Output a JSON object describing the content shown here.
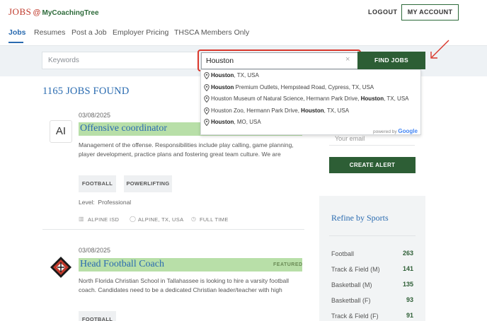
{
  "header": {
    "logo_jobs": "JOBS",
    "logo_at": "@",
    "logo_brand": "MyCoachingTree",
    "logout_label": "LOGOUT",
    "account_label": "MY ACCOUNT"
  },
  "nav": {
    "tabs": [
      {
        "label": "Jobs",
        "active": true
      },
      {
        "label": "Resumes"
      },
      {
        "label": "Post a Job"
      },
      {
        "label": "Employer Pricing"
      },
      {
        "label": "THSCA Members Only"
      }
    ]
  },
  "search": {
    "keywords_placeholder": "Keywords",
    "location_value": "Houston",
    "clear_icon": "×",
    "find_label": "FIND JOBS"
  },
  "autocomplete": {
    "items": [
      {
        "bold": "Houston",
        "rest": ", TX, USA"
      },
      {
        "bold": "Houston",
        "rest": " Premium Outlets, Hempstead Road, Cypress, TX, USA"
      },
      {
        "pre": "Houston Museum of Natural Science, Hermann Park Drive, ",
        "bold": "Houston",
        "rest": ", TX, USA"
      },
      {
        "pre": "Houston Zoo, Hermann Park Drive, ",
        "bold": "Houston",
        "rest": ", TX, USA"
      },
      {
        "bold": "Houston",
        "rest": ", MO, USA"
      }
    ],
    "powered_by": "powered by",
    "google": "Google"
  },
  "results": {
    "count_text": "1165 JOBS FOUND",
    "jobs": [
      {
        "logo_text": "AI",
        "date": "03/08/2025",
        "title": "Offensive coordinator",
        "description": "Management of the offense. Responsibilities include play calling, game planning, player development, practice plans and fostering great team culture. We are",
        "tags": [
          "FOOTBALL",
          "POWERLIFTING"
        ],
        "level_label": "Level:",
        "level_value": "Professional",
        "employer": "ALPINE ISD",
        "location": "ALPINE, TX, USA",
        "type": "FULL TIME"
      },
      {
        "date": "03/08/2025",
        "title": "Head Football Coach",
        "featured": "FEATURED",
        "description": "North Florida Christian School in Tallahassee is looking to hire a varsity football coach.   Candidates need to be a dedicated Christian leader/teacher with high",
        "tags": [
          "FOOTBALL"
        ]
      }
    ]
  },
  "sidebar": {
    "email_placeholder": "Your email",
    "create_alert_label": "CREATE ALERT",
    "refine_title": "Refine by Sports",
    "sports": [
      {
        "name": "Football",
        "count": "263"
      },
      {
        "name": "Track & Field (M)",
        "count": "141"
      },
      {
        "name": "Basketball (M)",
        "count": "135"
      },
      {
        "name": "Basketball (F)",
        "count": "93"
      },
      {
        "name": "Track & Field (F)",
        "count": "91"
      }
    ]
  },
  "colors": {
    "brand_green": "#2d5e35",
    "link_blue": "#2a6bb0",
    "highlight_red": "#d9362b",
    "title_highlight": "#b8dfa8"
  }
}
